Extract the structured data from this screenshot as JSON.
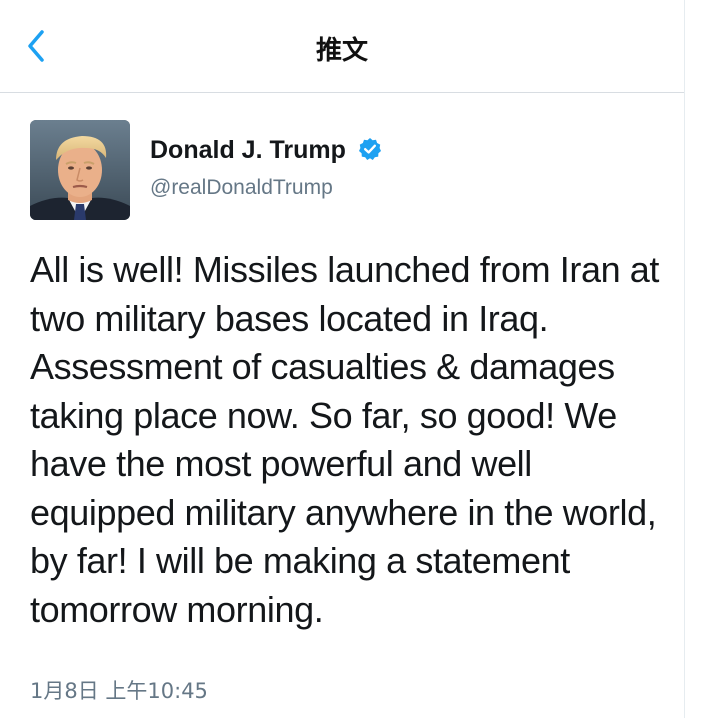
{
  "nav": {
    "title": "推文",
    "back_icon": "chevron-left-icon"
  },
  "author": {
    "display_name": "Donald J. Trump",
    "handle": "@realDonaldTrump",
    "verified": true
  },
  "tweet": {
    "text": "All is well! Missiles launched from Iran at two military bases located in Iraq. Assessment of casualties & damages taking place now. So far, so good! We have the most powerful and well equipped military anywhere in the world, by far! I will be making a statement tomorrow morning.",
    "timestamp": "1月8日 上午10:45"
  },
  "colors": {
    "accent": "#1da1f2",
    "text": "#14171a",
    "secondary_text": "#657786",
    "divider": "#d8dde2"
  }
}
